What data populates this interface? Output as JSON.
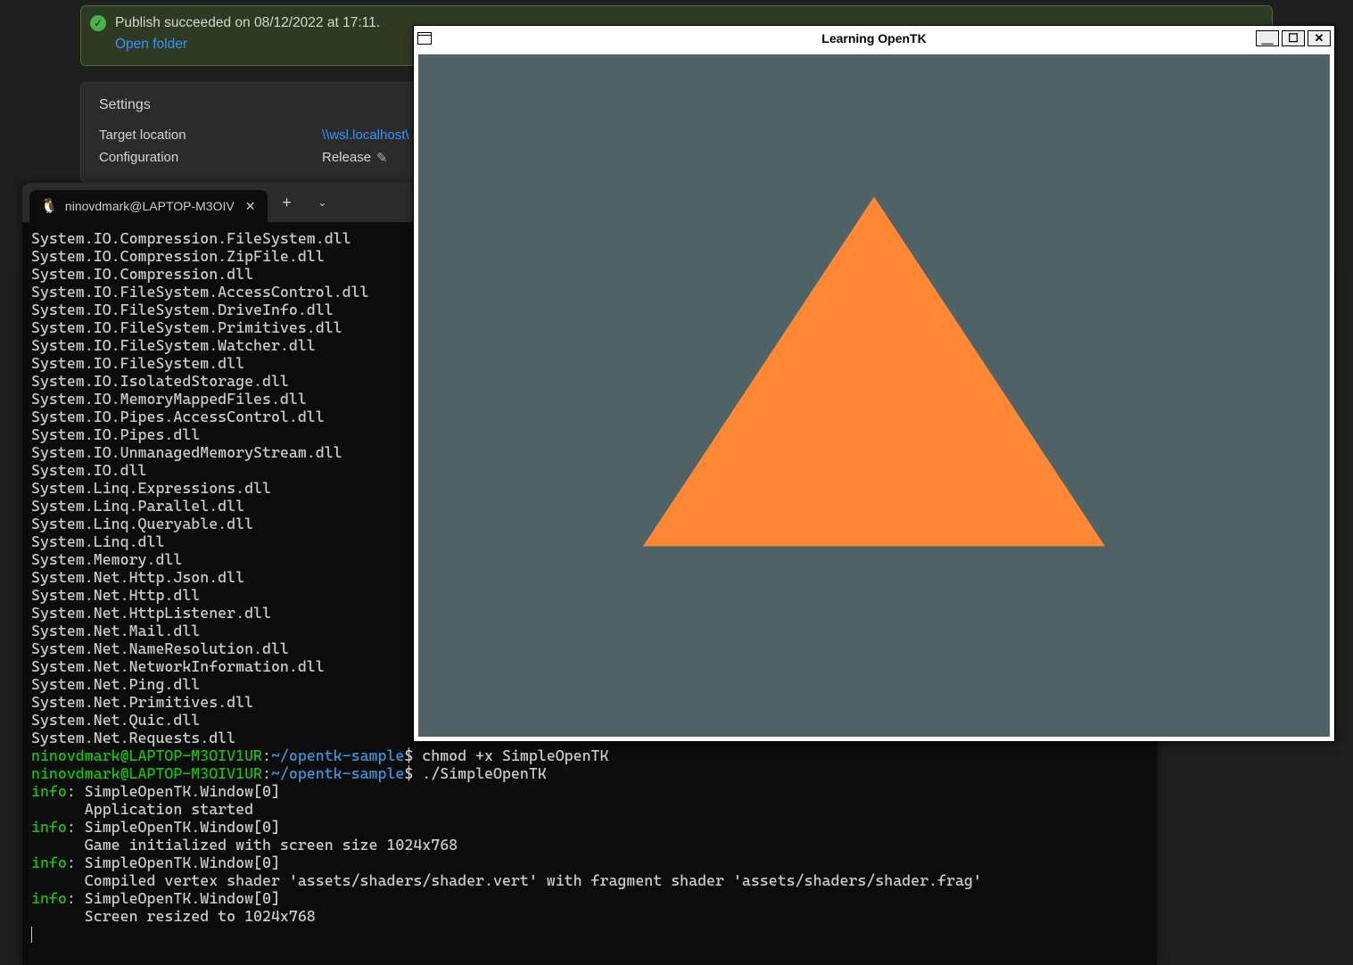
{
  "vs": {
    "success_text": "Publish succeeded on 08/12/2022 at 17:11.",
    "open_folder": "Open folder",
    "settings_header": "Settings",
    "target_label": "Target location",
    "target_value": "\\\\wsl.localhost\\",
    "config_label": "Configuration",
    "config_value": "Release"
  },
  "terminal": {
    "tab_title": "ninovdmark@LAPTOP-M3OIV",
    "dll_lines": [
      "System.IO.Compression.FileSystem.dll",
      "System.IO.Compression.ZipFile.dll",
      "System.IO.Compression.dll",
      "System.IO.FileSystem.AccessControl.dll",
      "System.IO.FileSystem.DriveInfo.dll",
      "System.IO.FileSystem.Primitives.dll",
      "System.IO.FileSystem.Watcher.dll",
      "System.IO.FileSystem.dll",
      "System.IO.IsolatedStorage.dll",
      "System.IO.MemoryMappedFiles.dll",
      "System.IO.Pipes.AccessControl.dll",
      "System.IO.Pipes.dll",
      "System.IO.UnmanagedMemoryStream.dll",
      "System.IO.dll",
      "System.Linq.Expressions.dll",
      "System.Linq.Parallel.dll",
      "System.Linq.Queryable.dll",
      "System.Linq.dll",
      "System.Memory.dll",
      "System.Net.Http.Json.dll",
      "System.Net.Http.dll",
      "System.Net.HttpListener.dll",
      "System.Net.Mail.dll",
      "System.Net.NameResolution.dll",
      "System.Net.NetworkInformation.dll",
      "System.Net.Ping.dll",
      "System.Net.Primitives.dll",
      "System.Net.Quic.dll",
      "System.Net.Requests.dll"
    ],
    "prompt_user": "ninovdmark@LAPTOP-M3OIV1UR",
    "prompt_path": "~/opentk-sample",
    "cmd1": "chmod +x SimpleOpenTK",
    "cmd2": "./SimpleOpenTK",
    "info_lines": [
      {
        "src": "SimpleOpenTK.Window[0]",
        "msg": "Application started"
      },
      {
        "src": "SimpleOpenTK.Window[0]",
        "msg": "Game initialized with screen size 1024x768"
      },
      {
        "src": "SimpleOpenTK.Window[0]",
        "msg": "Compiled vertex shader 'assets/shaders/shader.vert' with fragment shader 'assets/shaders/shader.frag'"
      },
      {
        "src": "SimpleOpenTK.Window[0]",
        "msg": "Screen resized to 1024x768"
      }
    ]
  },
  "gl": {
    "title": "Learning OpenTK",
    "triangle_color": "#fe8836",
    "bg_color": "#4f6367"
  }
}
